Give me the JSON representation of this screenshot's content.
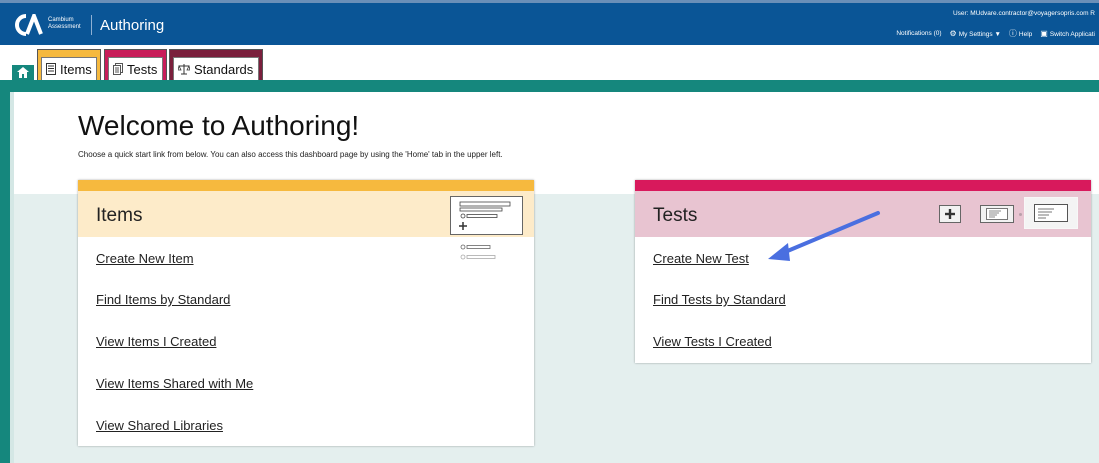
{
  "header": {
    "logo_text": "Cambium Assessment",
    "app_title": "Authoring",
    "user_line": "User: MUdvare.contractor@voyagersopris.com  R",
    "notifications": "Notifications (0)",
    "settings": "My Settings ▼",
    "help": "Help",
    "switch_app": "Switch Applicati"
  },
  "tabs": [
    {
      "label": "Items",
      "color": "#f6b93e"
    },
    {
      "label": "Tests",
      "color": "#c81d59"
    },
    {
      "label": "Standards",
      "color": "#7a1f3c"
    }
  ],
  "welcome": {
    "title": "Welcome to Authoring!",
    "subtitle": "Choose a quick start link from below. You can also access this dashboard page by using the 'Home' tab in the upper left."
  },
  "items_card": {
    "title": "Items",
    "links": [
      "Create New Item",
      "Find Items by Standard",
      "View Items I Created",
      "View Items Shared with Me",
      "View Shared Libraries"
    ]
  },
  "tests_card": {
    "title": "Tests",
    "links": [
      "Create New Test",
      "Find Tests by Standard",
      "View Tests I Created"
    ]
  },
  "colors": {
    "brand_blue": "#0a5596",
    "teal": "#15877d",
    "items_accent": "#f6b93e",
    "tests_accent": "#d8195c",
    "annotation_arrow": "#4a6fe0"
  }
}
